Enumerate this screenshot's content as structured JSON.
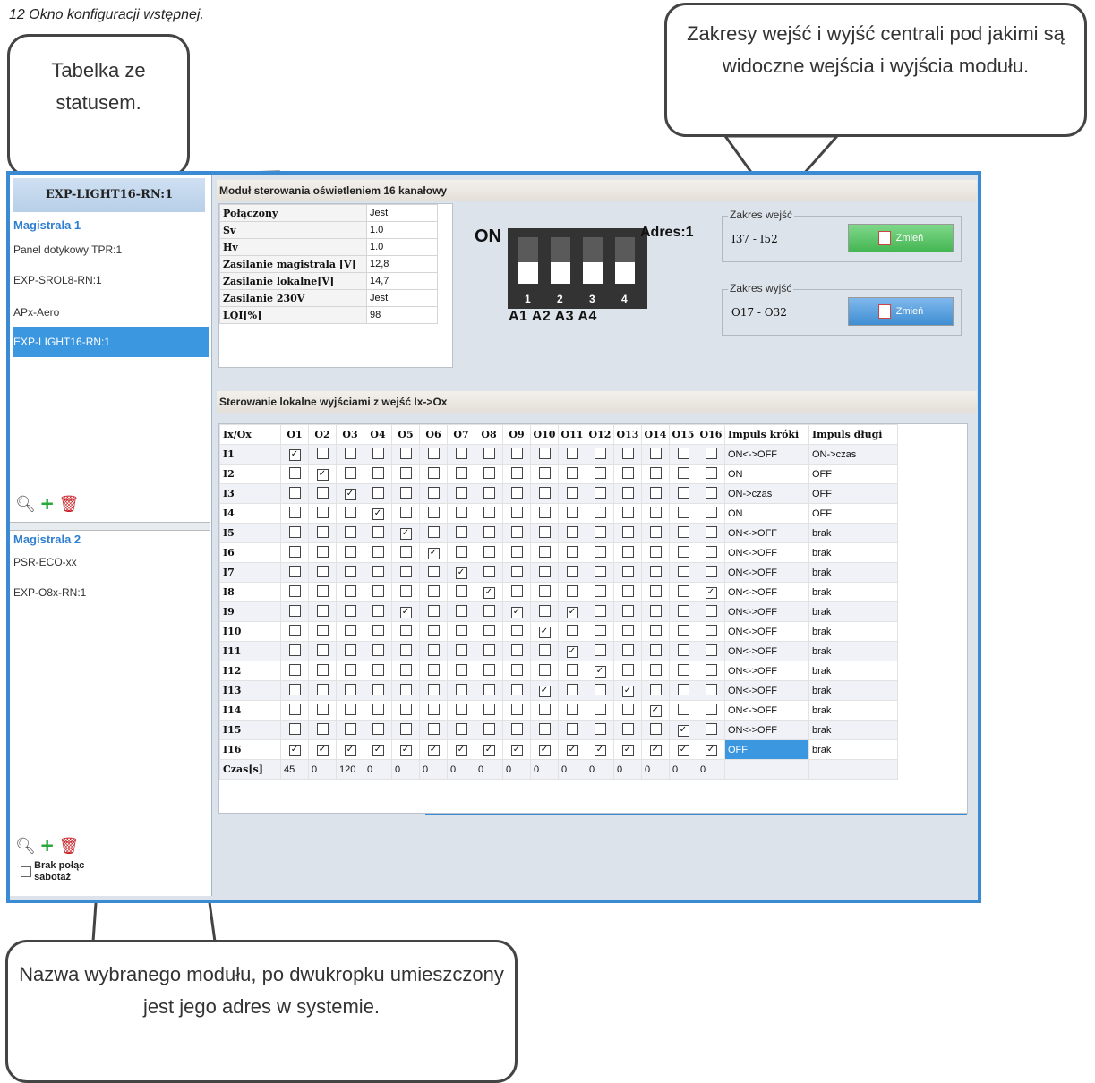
{
  "caption": "12 Okno konfiguracji wstępnej.",
  "callouts": {
    "left": "Tabelka ze statusem.",
    "right": "Zakresy wejść i wyjść centrali pod jakimi są widoczne wejścia i wyjścia modułu.",
    "bottom": "Nazwa wybranego modułu, po dwukropku umieszczony jest jego adres w systemie."
  },
  "sidebar": {
    "selected_title": "EXP-LIGHT16-RN:1",
    "group1": {
      "title": "Magistrala 1",
      "items": [
        "Panel dotykowy TPR:1",
        "EXP-SROL8-RN:1",
        "APx-Aero",
        "EXP-LIGHT16-RN:1"
      ]
    },
    "group2": {
      "title": "Magistrala 2",
      "items": [
        "PSR-ECO-xx",
        "EXP-O8x-RN:1"
      ]
    },
    "footer_checkbox": "Brak połąc sabotaż",
    "icons": [
      "search-icon",
      "add-icon",
      "delete-icon"
    ]
  },
  "module_title": "Moduł sterowania oświetleniem  16 kanałowy",
  "status": [
    {
      "k": "Połączony",
      "v": "Jest"
    },
    {
      "k": "Sv",
      "v": "1.0"
    },
    {
      "k": "Hv",
      "v": "1.0"
    },
    {
      "k": "Zasilanie magistrala [V]",
      "v": "12,8"
    },
    {
      "k": "Zasilanie lokalne[V]",
      "v": "14,7"
    },
    {
      "k": "Zasilanie 230V",
      "v": "Jest"
    },
    {
      "k": "LQI[%]",
      "v": "98"
    }
  ],
  "dip": {
    "on_label": "ON",
    "address": "Adres:1",
    "numbers": [
      "1",
      "2",
      "3",
      "4"
    ],
    "labels": "A1 A2 A3 A4"
  },
  "ranges": {
    "inputs": {
      "legend": "Zakres wejść",
      "value": "I37 - I52",
      "button": "Zmień"
    },
    "outputs": {
      "legend": "Zakres wyjść",
      "value": "O17 - O32",
      "button": "Zmień"
    }
  },
  "grid_title": "Sterowanie lokalne wyjściami z wejść Ix->Ox",
  "grid": {
    "corner": "Ix/Ox",
    "columns": [
      "O1",
      "O2",
      "O3",
      "O4",
      "O5",
      "O6",
      "O7",
      "O8",
      "O9",
      "O10",
      "O11",
      "O12",
      "O13",
      "O14",
      "O15",
      "O16"
    ],
    "short_header": "Impuls króki",
    "long_header": "Impuls długi",
    "rows": [
      {
        "label": "I1",
        "checked": [
          1
        ],
        "short": "ON<->OFF",
        "long": "ON->czas"
      },
      {
        "label": "I2",
        "checked": [
          2
        ],
        "short": "ON",
        "long": "OFF"
      },
      {
        "label": "I3",
        "checked": [
          3
        ],
        "short": "ON->czas",
        "long": "OFF"
      },
      {
        "label": "I4",
        "checked": [
          4
        ],
        "short": "ON",
        "long": "OFF"
      },
      {
        "label": "I5",
        "checked": [
          5
        ],
        "short": "ON<->OFF",
        "long": "brak"
      },
      {
        "label": "I6",
        "checked": [
          6
        ],
        "short": "ON<->OFF",
        "long": "brak"
      },
      {
        "label": "I7",
        "checked": [
          7
        ],
        "short": "ON<->OFF",
        "long": "brak"
      },
      {
        "label": "I8",
        "checked": [
          8,
          16
        ],
        "short": "ON<->OFF",
        "long": "brak"
      },
      {
        "label": "I9",
        "checked": [
          5,
          9,
          11
        ],
        "short": "ON<->OFF",
        "long": "brak"
      },
      {
        "label": "I10",
        "checked": [
          10
        ],
        "short": "ON<->OFF",
        "long": "brak"
      },
      {
        "label": "I11",
        "checked": [
          11
        ],
        "short": "ON<->OFF",
        "long": "brak"
      },
      {
        "label": "I12",
        "checked": [
          12
        ],
        "short": "ON<->OFF",
        "long": "brak"
      },
      {
        "label": "I13",
        "checked": [
          10,
          13
        ],
        "short": "ON<->OFF",
        "long": "brak"
      },
      {
        "label": "I14",
        "checked": [
          14
        ],
        "short": "ON<->OFF",
        "long": "brak"
      },
      {
        "label": "I15",
        "checked": [
          15
        ],
        "short": "ON<->OFF",
        "long": "brak"
      },
      {
        "label": "I16",
        "checked": [
          1,
          2,
          3,
          4,
          5,
          6,
          7,
          8,
          9,
          10,
          11,
          12,
          13,
          14,
          15,
          16
        ],
        "short": "OFF",
        "long": "brak",
        "short_selected": true
      }
    ],
    "time_label": "Czas[s]",
    "times": [
      "45",
      "0",
      "120",
      "0",
      "0",
      "0",
      "0",
      "0",
      "0",
      "0",
      "0",
      "0",
      "0",
      "0",
      "0",
      "0"
    ]
  }
}
